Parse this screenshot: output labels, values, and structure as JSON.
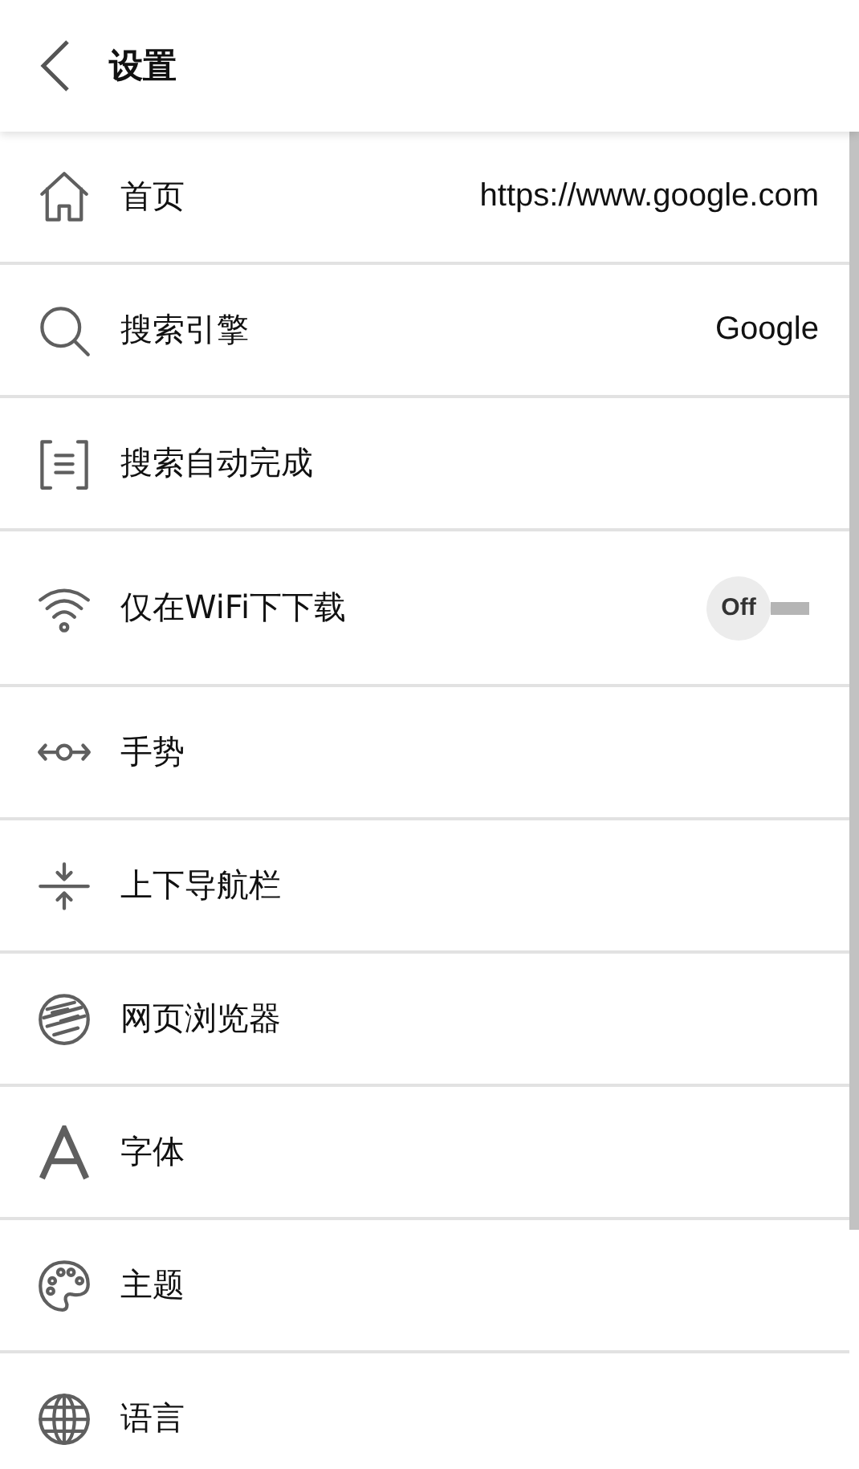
{
  "header": {
    "title": "设置"
  },
  "items": [
    {
      "kind": "value",
      "label": "首页",
      "value": "https://www.google.com"
    },
    {
      "kind": "value",
      "label": "搜索引擎",
      "value": "Google"
    },
    {
      "kind": "plain",
      "label": "搜索自动完成"
    },
    {
      "kind": "toggle",
      "label": "仅在WiFi下下载",
      "on": false,
      "state_text": "Off"
    },
    {
      "kind": "plain",
      "label": "手势"
    },
    {
      "kind": "plain",
      "label": "上下导航栏"
    },
    {
      "kind": "plain",
      "label": "网页浏览器"
    },
    {
      "kind": "plain",
      "label": "字体"
    },
    {
      "kind": "plain",
      "label": "主题"
    },
    {
      "kind": "plain",
      "label": "语言"
    }
  ]
}
